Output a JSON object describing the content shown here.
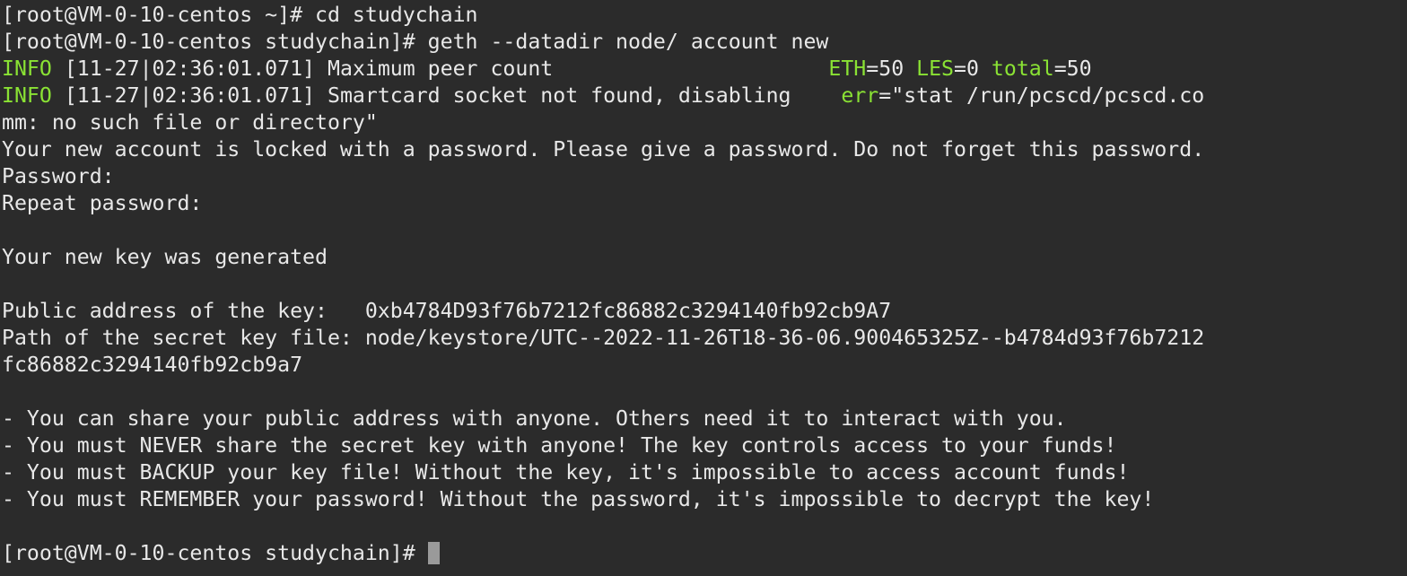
{
  "terminal": {
    "colors": {
      "background": "#2b2b2b",
      "foreground": "#e8e8e8",
      "green": "#8ae234",
      "cursor": "#9a9a9a"
    },
    "lines": [
      {
        "type": "prompt",
        "prompt": "[root@VM-0-10-centos ~]# ",
        "command": "cd studychain"
      },
      {
        "type": "prompt",
        "prompt": "[root@VM-0-10-centos studychain]# ",
        "command": "geth --datadir node/ account new"
      },
      {
        "type": "log",
        "level": "INFO",
        "timestamp": "[11-27|02:36:01.071]",
        "message": "Maximum peer count                      ",
        "fields": [
          {
            "key": "ETH",
            "value": "=50 "
          },
          {
            "key": "LES",
            "value": "=0 "
          },
          {
            "key": "total",
            "value": "=50"
          }
        ]
      },
      {
        "type": "log",
        "level": "INFO",
        "timestamp": "[11-27|02:36:01.071]",
        "message": "Smartcard socket not found, disabling    ",
        "fields": [
          {
            "key": "err",
            "value": "=\"stat /run/pcscd/pcscd.co"
          }
        ]
      },
      {
        "type": "text",
        "text": "mm: no such file or directory\""
      },
      {
        "type": "text",
        "text": "Your new account is locked with a password. Please give a password. Do not forget this password."
      },
      {
        "type": "text",
        "text": "Password:"
      },
      {
        "type": "text",
        "text": "Repeat password:"
      },
      {
        "type": "blank"
      },
      {
        "type": "text",
        "text": "Your new key was generated"
      },
      {
        "type": "blank"
      },
      {
        "type": "text",
        "text": "Public address of the key:   0xb4784D93f76b7212fc86882c3294140fb92cb9A7"
      },
      {
        "type": "text",
        "text": "Path of the secret key file: node/keystore/UTC--2022-11-26T18-36-06.900465325Z--b4784d93f76b7212"
      },
      {
        "type": "text",
        "text": "fc86882c3294140fb92cb9a7"
      },
      {
        "type": "blank"
      },
      {
        "type": "text",
        "text": "- You can share your public address with anyone. Others need it to interact with you."
      },
      {
        "type": "text",
        "text": "- You must NEVER share the secret key with anyone! The key controls access to your funds!"
      },
      {
        "type": "text",
        "text": "- You must BACKUP your key file! Without the key, it's impossible to access account funds!"
      },
      {
        "type": "text",
        "text": "- You must REMEMBER your password! Without the password, it's impossible to decrypt the key!"
      },
      {
        "type": "blank"
      },
      {
        "type": "prompt-cursor",
        "prompt": "[root@VM-0-10-centos studychain]# ",
        "command": ""
      }
    ]
  }
}
